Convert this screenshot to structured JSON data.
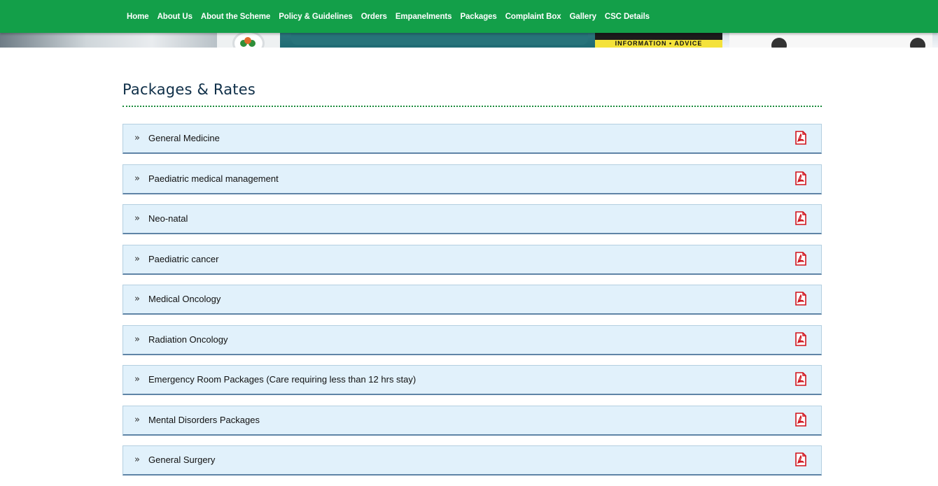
{
  "nav": {
    "items": [
      {
        "label": "Home"
      },
      {
        "label": "About Us"
      },
      {
        "label": "About the Scheme"
      },
      {
        "label": "Policy & Guidelines"
      },
      {
        "label": "Orders"
      },
      {
        "label": "Empanelments"
      },
      {
        "label": "Packages"
      },
      {
        "label": "Complaint Box"
      },
      {
        "label": "Gallery"
      },
      {
        "label": "CSC Details"
      }
    ]
  },
  "banner": {
    "info_text": "INFORMATION • ADVICE"
  },
  "page": {
    "title": "Packages & Rates"
  },
  "packages": [
    {
      "label": "General Medicine",
      "icon": "pdf-icon"
    },
    {
      "label": "Paediatric medical management",
      "icon": "pdf-icon"
    },
    {
      "label": "Neo-natal",
      "icon": "pdf-icon"
    },
    {
      "label": "Paediatric cancer",
      "icon": "pdf-icon"
    },
    {
      "label": "Medical Oncology",
      "icon": "pdf-icon"
    },
    {
      "label": "Radiation Oncology",
      "icon": "pdf-icon"
    },
    {
      "label": "Emergency Room Packages (Care requiring less than 12 hrs stay)",
      "icon": "pdf-icon"
    },
    {
      "label": "Mental Disorders Packages",
      "icon": "pdf-icon"
    },
    {
      "label": "General Surgery",
      "icon": "pdf-icon"
    }
  ],
  "colors": {
    "nav_bg": "#139f49",
    "title": "#0f2f48",
    "item_bg": "#e1f1fb",
    "pdf_icon": "#d0121b"
  }
}
